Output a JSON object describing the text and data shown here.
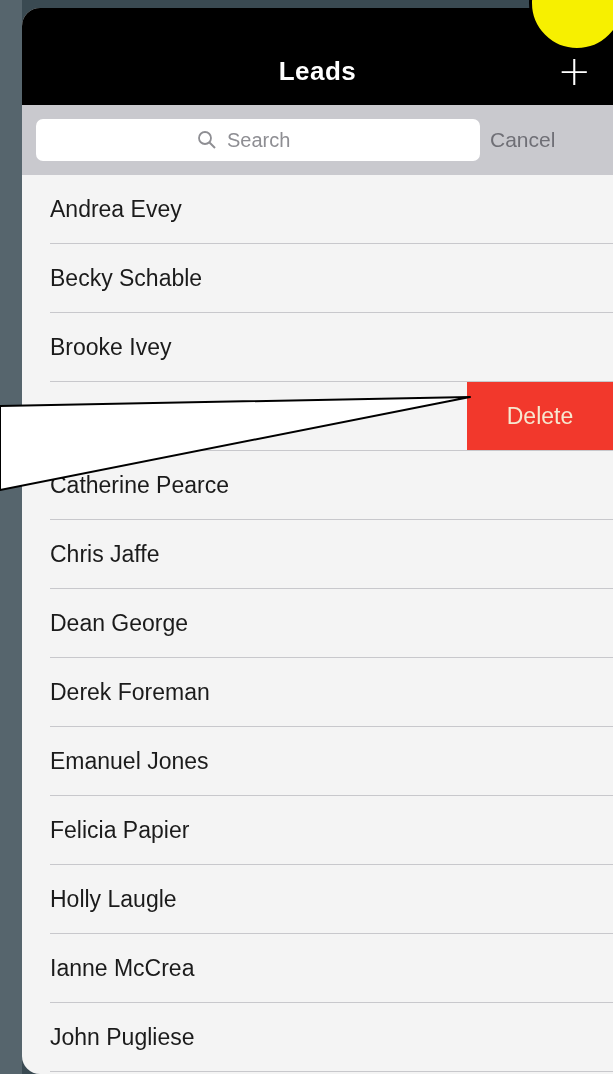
{
  "header": {
    "title": "Leads",
    "add_symbol": "+"
  },
  "search": {
    "placeholder": "Search",
    "cancel": "Cancel"
  },
  "rows": [
    {
      "kind": "plain",
      "name": "Andrea Evey"
    },
    {
      "kind": "plain",
      "name": "Becky Schable"
    },
    {
      "kind": "plain",
      "name": "Brooke Ivey"
    },
    {
      "kind": "swiped",
      "action": "Delete"
    },
    {
      "kind": "plain",
      "name": "Catherine Pearce"
    },
    {
      "kind": "plain",
      "name": "Chris Jaffe"
    },
    {
      "kind": "plain",
      "name": "Dean George"
    },
    {
      "kind": "plain",
      "name": "Derek Foreman"
    },
    {
      "kind": "plain",
      "name": "Emanuel Jones"
    },
    {
      "kind": "plain",
      "name": "Felicia Papier"
    },
    {
      "kind": "plain",
      "name": "Holly Laugle"
    },
    {
      "kind": "plain",
      "name": "Ianne McCrea"
    },
    {
      "kind": "plain",
      "name": "John Pugliese"
    }
  ]
}
